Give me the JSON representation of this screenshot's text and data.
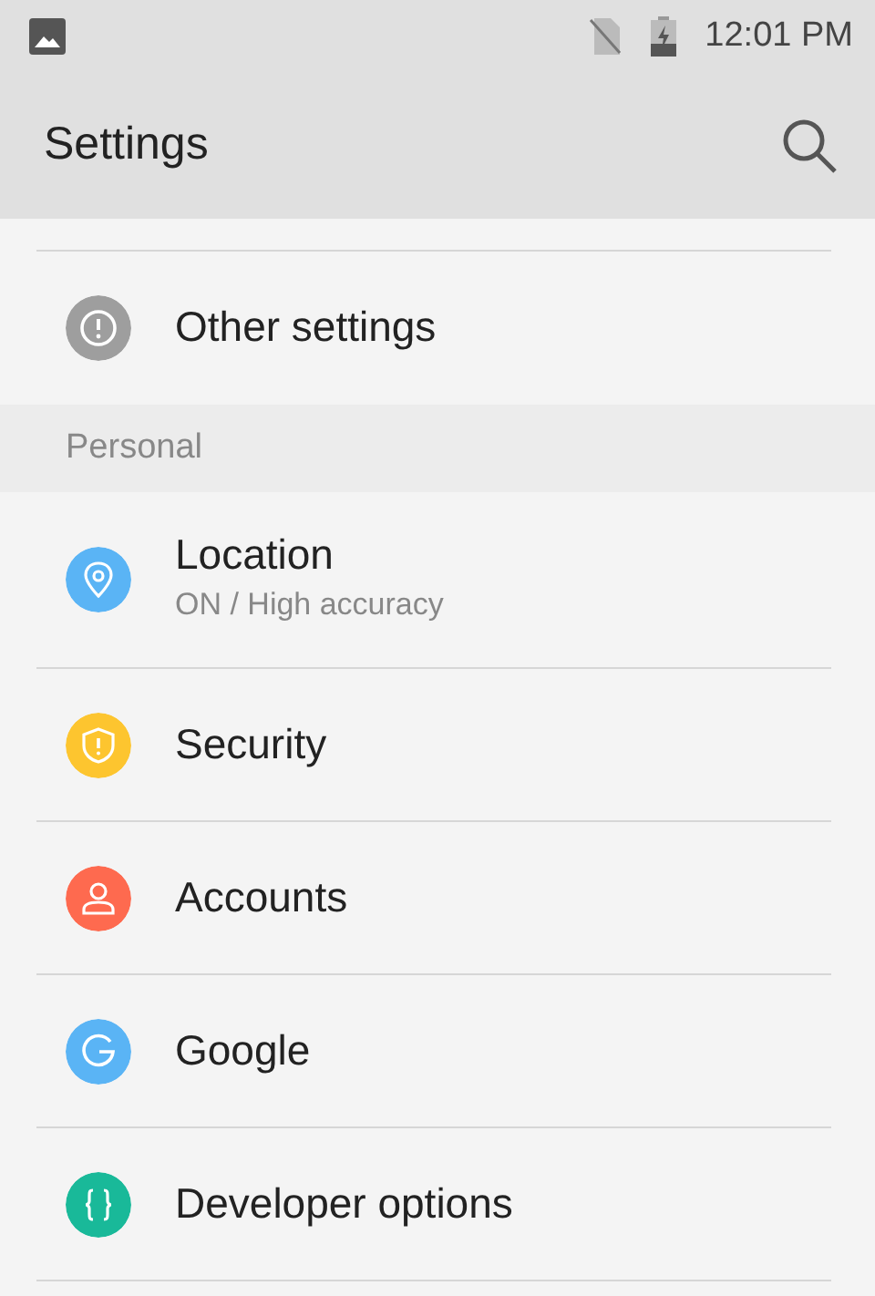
{
  "status_bar": {
    "time": "12:01 PM"
  },
  "toolbar": {
    "title": "Settings"
  },
  "groups": [
    {
      "items": [
        {
          "kind": "info",
          "title": "Other settings",
          "color": "#9e9e9e"
        }
      ]
    },
    {
      "header": "Personal",
      "items": [
        {
          "kind": "location",
          "title": "Location",
          "subtitle": "ON / High accuracy",
          "color": "#5ab4f5"
        },
        {
          "kind": "security",
          "title": "Security",
          "color": "#fdc52f"
        },
        {
          "kind": "accounts",
          "title": "Accounts",
          "color": "#fe6a4f"
        },
        {
          "kind": "google",
          "title": "Google",
          "color": "#5ab4f5"
        },
        {
          "kind": "developer",
          "title": "Developer options",
          "color": "#19b999"
        }
      ]
    }
  ]
}
